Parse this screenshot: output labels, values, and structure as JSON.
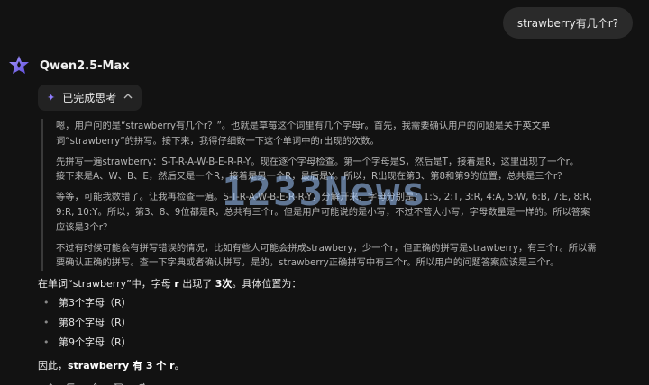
{
  "user_message": "strawberry有几个r?",
  "assistant": {
    "model_name": "Qwen2.5-Max",
    "thinking_toggle_label": "已完成思考",
    "thinking_paragraphs": [
      [
        "嗯，用户问的是“strawberry有几个r？”。也就是草莓这个词里有几个字母r。首先，我需要确认用户的问题是关于英文单",
        "词“strawberry”的拼写。接下来，我得仔细数一下这个单词中的r出现的次数。"
      ],
      [
        "先拼写一遍strawberry：S-T-R-A-W-B-E-R-R-Y。现在逐个字母检查。第一个字母是S，然后是T，接着是R，这里出现了一个r。",
        "接下来是A、W、B、E，然后又是一个R，接着是另一个R，最后是Y。所以，R出现在第3、第8和第9的位置，总共是三个r？"
      ],
      [
        "等等，可能我数错了。让我再检查一遍。S-T-R-A-W-B-E-R-R-Y，分解开来，字母分别是：1:S, 2:T, 3:R, 4:A, 5:W, 6:B, 7:E, 8:R,",
        "9:R, 10:Y。所以，第3、8、9位都是R，总共有三个r。但是用户可能说的是小写，不过不管大小写，字母数量是一样的。所以答案",
        "应该是3个r？"
      ],
      [
        "不过有时候可能会有拼写错误的情况，比如有些人可能会拼成strawbery，少一个r，但正确的拼写是strawberry，有三个r。所以需",
        "要确认正确的拼写。查一下字典或者确认拼写，是的，strawberry正确拼写中有三个r。所以用户的问题答案应该是三个r。"
      ]
    ],
    "answer": {
      "intro_prefix": "在单词“strawberry”中，字母 ",
      "intro_letter": "r",
      "intro_middle": " 出现了 ",
      "intro_count": "3次",
      "intro_suffix": "。具体位置为：",
      "positions": [
        "第3个字母（R）",
        "第8个字母（R）",
        "第9个字母（R）"
      ],
      "final_prefix": "因此，",
      "final_bold": "strawberry 有 3 个 r",
      "final_suffix": "。"
    }
  },
  "watermark": "1233News",
  "colors": {
    "accent": "#8f7dff",
    "background": "#121212",
    "bubble": "#2a2a2a"
  },
  "actions": [
    "edit-icon",
    "copy-icon",
    "thumbs-up-icon",
    "thumbs-down-icon",
    "regenerate-icon"
  ]
}
